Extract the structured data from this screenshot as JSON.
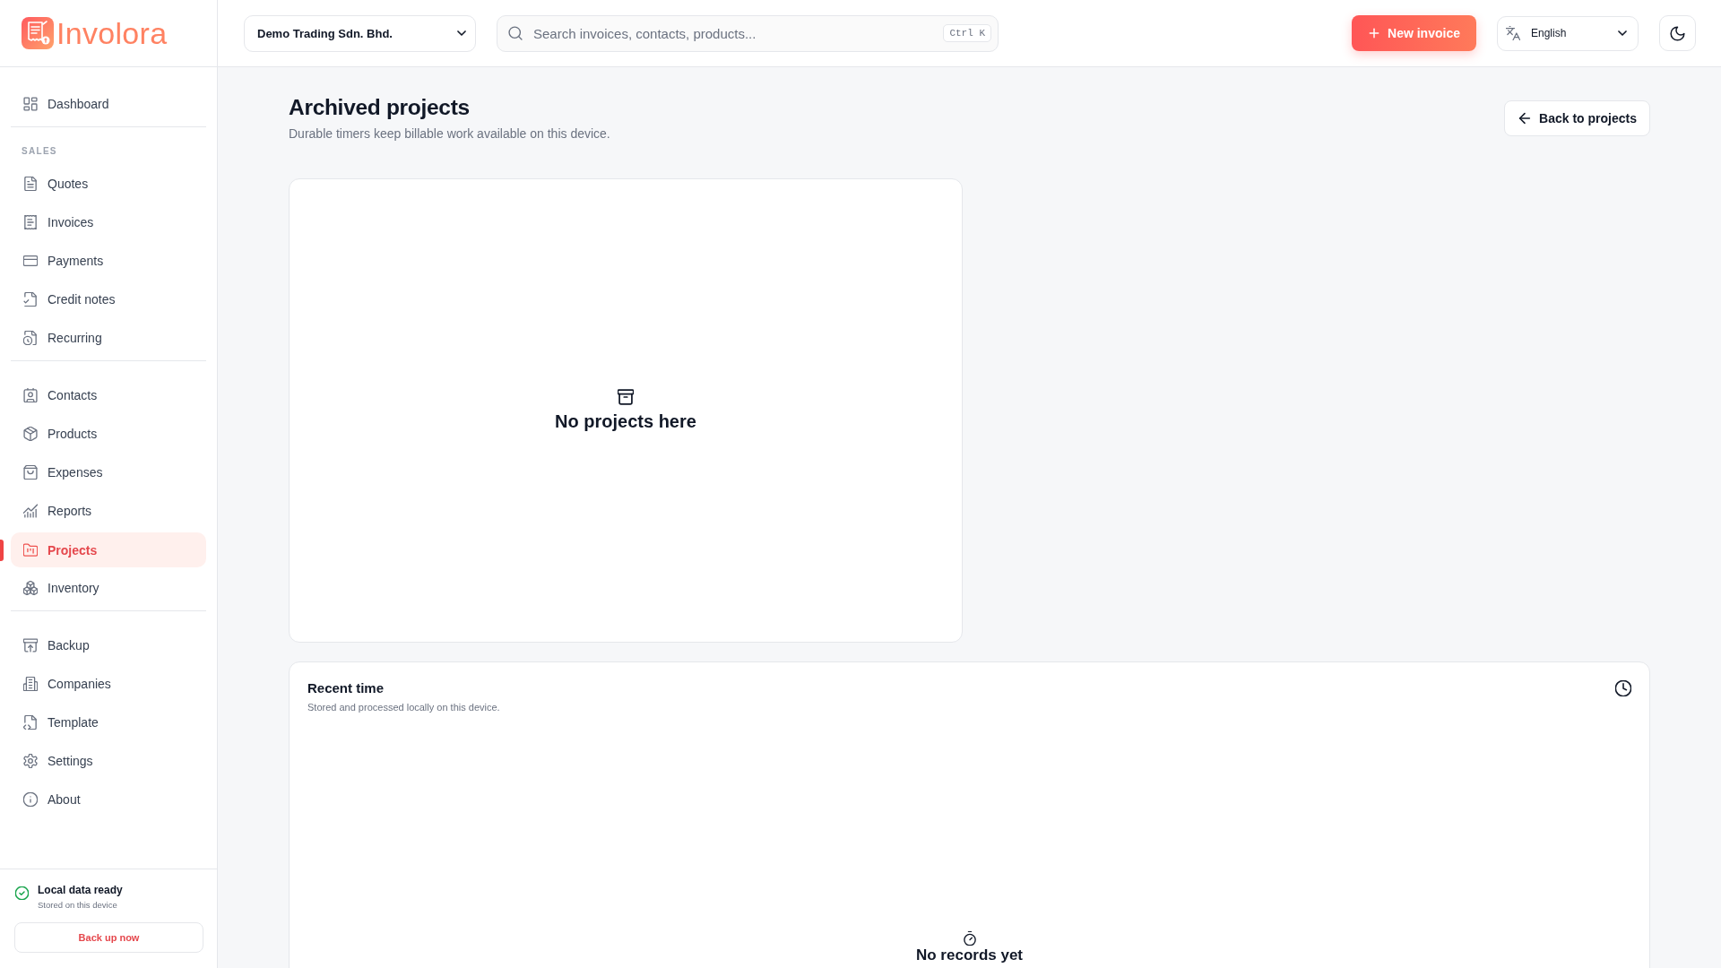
{
  "sidebar": {
    "brand": "Involora",
    "sections": [
      {
        "items": [
          {
            "label": "Dashboard",
            "selected": false
          }
        ]
      },
      {
        "heading": "SALES",
        "items": [
          {
            "label": "Quotes",
            "selected": false
          },
          {
            "label": "Invoices",
            "selected": false
          },
          {
            "label": "Payments",
            "selected": false
          },
          {
            "label": "Credit notes",
            "selected": false
          },
          {
            "label": "Recurring",
            "selected": false
          }
        ]
      },
      {
        "items": [
          {
            "label": "Contacts",
            "selected": false
          },
          {
            "label": "Products",
            "selected": false
          },
          {
            "label": "Expenses",
            "selected": false
          },
          {
            "label": "Reports",
            "selected": false
          },
          {
            "label": "Projects",
            "selected": true
          },
          {
            "label": "Inventory",
            "selected": false
          }
        ]
      },
      {
        "items": [
          {
            "label": "Backup",
            "selected": false
          },
          {
            "label": "Companies",
            "selected": false
          },
          {
            "label": "Template",
            "selected": false
          },
          {
            "label": "Settings",
            "selected": false
          },
          {
            "label": "About",
            "selected": false
          }
        ]
      }
    ],
    "status": {
      "title": "Local data ready",
      "subtitle": "Stored on this device",
      "action": "Back up now"
    }
  },
  "topbar": {
    "company_select": {
      "value": "Demo Trading Sdn. Bhd."
    },
    "search": {
      "placeholder": "Search invoices, contacts, products...",
      "shortcut": "Ctrl K"
    },
    "new_invoice_button": "New invoice",
    "language_select": {
      "value": "English"
    }
  },
  "page": {
    "title": "Archived projects",
    "subtitle": "Durable timers keep billable work available on this device.",
    "back_button": "Back to projects",
    "projects_panel": {
      "empty_text": "No projects here"
    },
    "recent_time": {
      "title": "Recent time",
      "subtitle": "Stored and processed locally on this device.",
      "empty_text": "No records yet"
    }
  }
}
